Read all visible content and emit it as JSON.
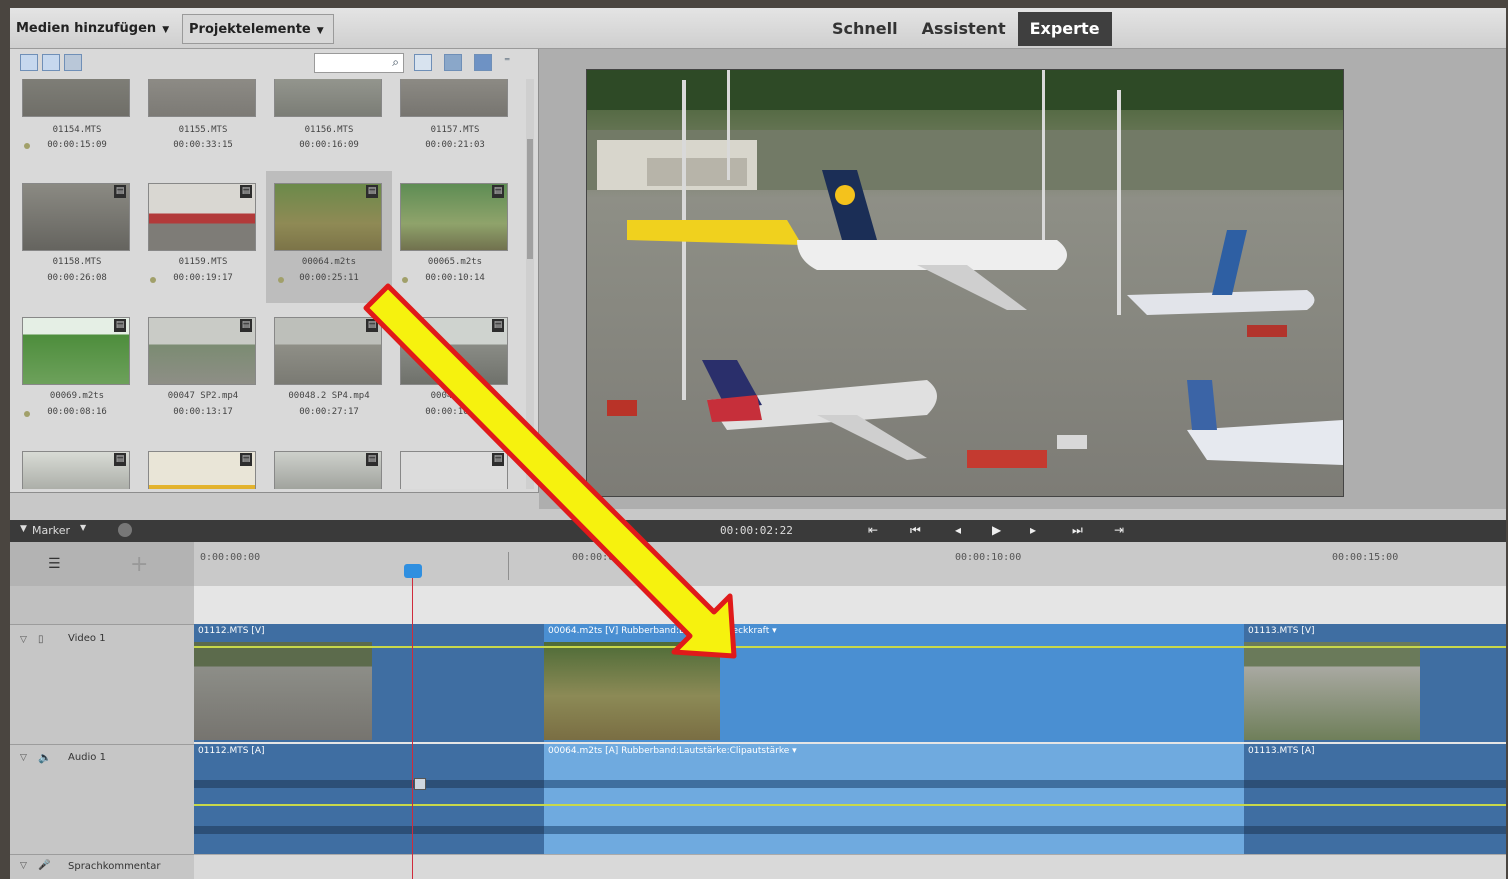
{
  "toolbar": {
    "media_add_label": "Medien hinzufügen",
    "project_elements_label": "Projektelemente",
    "modes": [
      "Schnell",
      "Assistent",
      "Experte"
    ],
    "active_mode": "Experte"
  },
  "media": {
    "items": [
      {
        "name": "01154.MTS",
        "duration": "00:00:15:09"
      },
      {
        "name": "01155.MTS",
        "duration": "00:00:33:15"
      },
      {
        "name": "01156.MTS",
        "duration": "00:00:16:09"
      },
      {
        "name": "01157.MTS",
        "duration": "00:00:21:03"
      },
      {
        "name": "01158.MTS",
        "duration": "00:00:26:08"
      },
      {
        "name": "01159.MTS",
        "duration": "00:00:19:17"
      },
      {
        "name": "00064.m2ts",
        "duration": "00:00:25:11"
      },
      {
        "name": "00065.m2ts",
        "duration": "00:00:10:14"
      },
      {
        "name": "00069.m2ts",
        "duration": "00:00:08:16"
      },
      {
        "name": "00047 SP2.mp4",
        "duration": "00:00:13:17"
      },
      {
        "name": "00048.2 SP4.mp4",
        "duration": "00:00:27:17"
      },
      {
        "name": "00048.mp4",
        "duration": "00:00:10:13"
      }
    ]
  },
  "transport": {
    "marker_label": "Marker",
    "timecode": "00:00:02:22"
  },
  "ruler": {
    "ticks": [
      "0:00:00:00",
      "00:00:05:00",
      "00:00:10:00",
      "00:00:15:00"
    ]
  },
  "tracks": {
    "video": {
      "name": "Video 1",
      "clip1": "01112.MTS [V]",
      "clip2": "00064.m2ts [V] Rubberband:Deckkraft:Deckkraft ▾",
      "clip3": "01113.MTS [V]"
    },
    "audio": {
      "name": "Audio 1",
      "clip1": "01112.MTS [A]",
      "clip2": "00064.m2ts [A] Rubberband:Lautstärke:Clipautstärke ▾",
      "clip3": "01113.MTS [A]"
    },
    "narration": {
      "name": "Sprachkommentar"
    }
  }
}
